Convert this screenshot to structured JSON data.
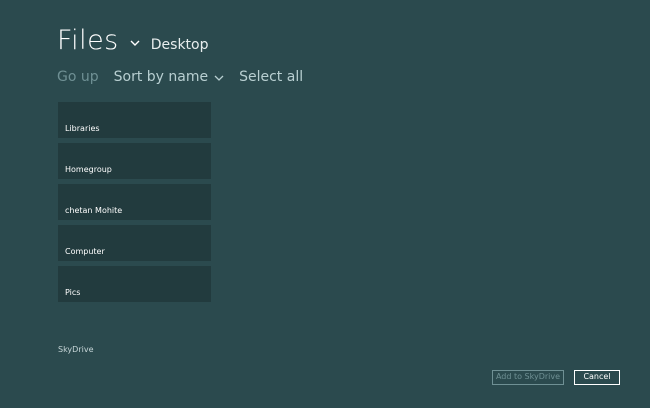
{
  "header": {
    "title": "Files",
    "location": "Desktop",
    "title_menu_icon": "chevron-down-icon"
  },
  "toolbar": {
    "go_up": "Go up",
    "sort": "Sort by name",
    "sort_icon": "chevron-down-icon",
    "select_all": "Select all"
  },
  "files": {
    "items": [
      {
        "label": "Libraries"
      },
      {
        "label": "Homegroup"
      },
      {
        "label": "chetan Mohite"
      },
      {
        "label": "Computer"
      },
      {
        "label": "Pics"
      }
    ]
  },
  "footer": {
    "skydrive": "SkyDrive",
    "add_button": "Add to SkyDrive",
    "cancel_button": "Cancel"
  },
  "colors": {
    "background": "#2b4a4e",
    "tile": "#223b3e",
    "disabled_text": "#6f9094",
    "text": "#ffffff"
  }
}
